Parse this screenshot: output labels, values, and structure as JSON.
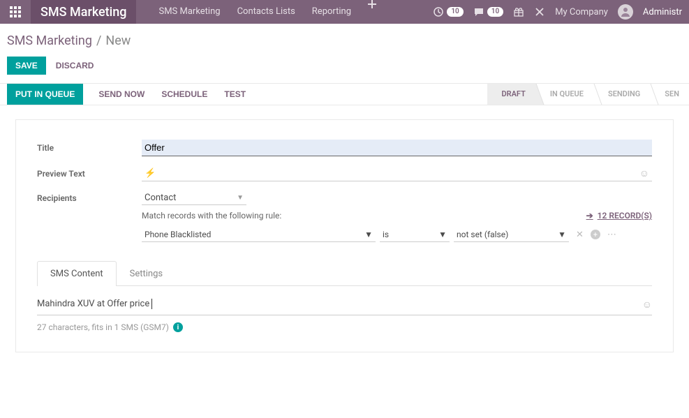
{
  "navbar": {
    "brand": "SMS Marketing",
    "links": [
      "SMS Marketing",
      "Contacts Lists",
      "Reporting"
    ],
    "clock_badge": "10",
    "chat_badge": "10",
    "company": "My Company",
    "user": "Administr"
  },
  "breadcrumb": {
    "root": "SMS Marketing",
    "current": "New"
  },
  "buttons": {
    "save": "SAVE",
    "discard": "DISCARD"
  },
  "actions": {
    "queue": "PUT IN QUEUE",
    "send": "SEND NOW",
    "schedule": "SCHEDULE",
    "test": "TEST"
  },
  "status": [
    "DRAFT",
    "IN QUEUE",
    "SENDING",
    "SEN"
  ],
  "form": {
    "title_label": "Title",
    "title_value": "Offer",
    "preview_label": "Preview Text",
    "recipients_label": "Recipients",
    "recipients_value": "Contact",
    "match_text": "Match records with the following rule:",
    "records_count": "12 RECORD(S)",
    "rule_field": "Phone Blacklisted",
    "rule_op": "is",
    "rule_value": "not set (false)"
  },
  "tabs": {
    "content": "SMS Content",
    "settings": "Settings"
  },
  "editor": {
    "body": "Mahindra XUV at Offer price",
    "footer": "27 characters, fits in 1 SMS (GSM7)"
  }
}
